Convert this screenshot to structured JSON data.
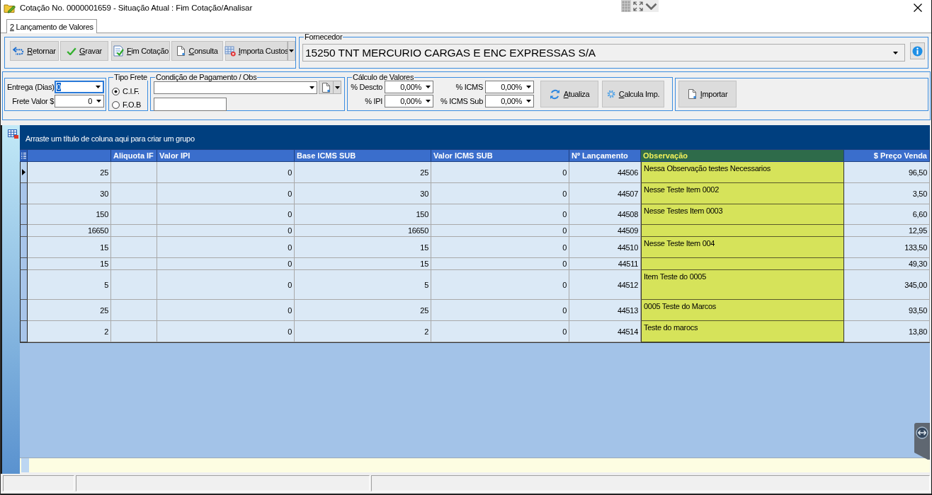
{
  "window": {
    "title": "Cotação No. 0000001659 - Situação Atual : Fim Cotação/Analisar"
  },
  "tabs": [
    {
      "label": "2 Lançamento de Valores",
      "selected": true
    }
  ],
  "toolbar": [
    {
      "label": "Retornar",
      "kind": "button"
    },
    {
      "label": "Gravar",
      "kind": "button"
    },
    {
      "label": "Fim Cotação",
      "kind": "button"
    },
    {
      "label": "Consulta",
      "kind": "button"
    },
    {
      "label": "Importa Custos",
      "kind": "split"
    }
  ],
  "supplier": {
    "legend": "Fornecedor",
    "value": "15250 TNT MERCURIO CARGAS E ENC EXPRESSAS S/A"
  },
  "delivery": {
    "fields": [
      {
        "label": "Entrega (Dias)",
        "value": "0",
        "focused": true
      },
      {
        "label": "Frete Valor $",
        "value": "0",
        "focused": false
      }
    ]
  },
  "freight_type": {
    "legend": "Tipo Frete",
    "options": [
      {
        "label": "C.I.F.",
        "selected": true
      },
      {
        "label": "F.O.B",
        "selected": false
      }
    ]
  },
  "payment": {
    "legend": "Condição de Pagamento / Obs"
  },
  "calculation": {
    "legend": "Cálculo de Valores",
    "fields": [
      {
        "label": "% Descto",
        "value": "0,00%"
      },
      {
        "label": "% ICMS",
        "value": "0,00%"
      },
      {
        "label": "% IPI",
        "value": "0,00%"
      },
      {
        "label": "% ICMS Sub",
        "value": "0,00%"
      }
    ],
    "buttons": [
      {
        "label": "Atualiza"
      },
      {
        "label": "Calcula Imp."
      }
    ]
  },
  "import": {
    "button": {
      "label": "Importar"
    }
  },
  "grid": {
    "group_hint": "Arraste um título de coluna aqui para criar um grupo",
    "columns": [
      {
        "kind": "number"
      },
      {
        "label": "Aliquota IF",
        "kind": "number"
      },
      {
        "label": "Valor IPI",
        "kind": "number"
      },
      {
        "label": "Base ICMS SUB",
        "kind": "number"
      },
      {
        "label": "Valor ICMS SUB",
        "kind": "number"
      },
      {
        "label": "Nº Lançamento",
        "kind": "number"
      },
      {
        "label": "Observação",
        "kind": "note"
      },
      {
        "label": "$ Preço Venda",
        "kind": "money"
      }
    ],
    "rows": [
      {
        "selected": true,
        "column_1": "25",
        "valor_ipi": "0",
        "base_icms_sub": "25",
        "valor_icms_sub": "0",
        "n_lancamento": "44506",
        "observacao": "Nessa Observação testes Necessarios",
        "preco_venda": "96,50"
      },
      {
        "selected": false,
        "column_1": "30",
        "valor_ipi": "0",
        "base_icms_sub": "30",
        "valor_icms_sub": "0",
        "n_lancamento": "44507",
        "observacao": "Nesse Teste Item 0002",
        "preco_venda": "3,50"
      },
      {
        "selected": false,
        "column_1": "150",
        "valor_ipi": "0",
        "base_icms_sub": "150",
        "valor_icms_sub": "0",
        "n_lancamento": "44508",
        "observacao": "Nesse Testes Item 0003",
        "preco_venda": "6,60"
      },
      {
        "selected": false,
        "column_1": "16650",
        "valor_ipi": "0",
        "base_icms_sub": "16650",
        "valor_icms_sub": "0",
        "n_lancamento": "44509",
        "preco_venda": "12,95"
      },
      {
        "selected": false,
        "column_1": "15",
        "valor_ipi": "0",
        "base_icms_sub": "15",
        "valor_icms_sub": "0",
        "n_lancamento": "44510",
        "observacao": "Nesse Teste Item 004",
        "preco_venda": "133,50"
      },
      {
        "selected": false,
        "column_1": "15",
        "valor_ipi": "0",
        "base_icms_sub": "15",
        "valor_icms_sub": "0",
        "n_lancamento": "44511",
        "preco_venda": "49,30"
      },
      {
        "selected": false,
        "column_1": "5",
        "valor_ipi": "0",
        "base_icms_sub": "5",
        "valor_icms_sub": "0",
        "n_lancamento": "44512",
        "observacao": "Item Teste do 0005",
        "preco_venda": "345,00"
      },
      {
        "selected": false,
        "column_1": "25",
        "valor_ipi": "0",
        "base_icms_sub": "25",
        "valor_icms_sub": "0",
        "n_lancamento": "44513",
        "observacao": "0005 Teste do Marcos",
        "preco_venda": "93,50"
      },
      {
        "selected": false,
        "column_1": "2",
        "valor_ipi": "0",
        "base_icms_sub": "2",
        "valor_icms_sub": "0",
        "n_lancamento": "44514",
        "observacao": "Teste do marocs",
        "preco_venda": "13,80"
      }
    ]
  }
}
